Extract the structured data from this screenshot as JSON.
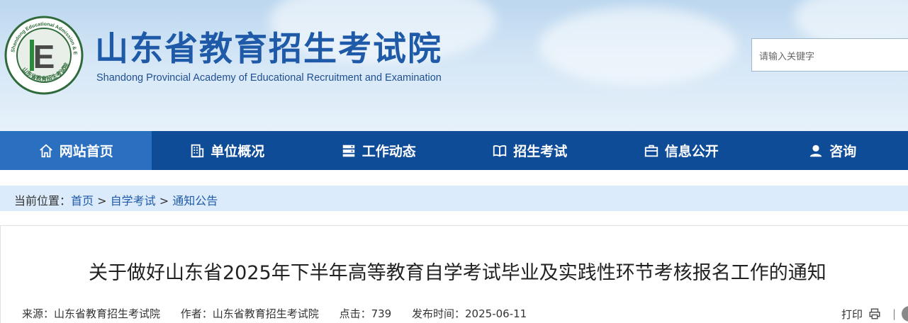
{
  "header": {
    "title": "山东省教育招生考试院",
    "subtitle": "Shandong Provincial Academy of Educational Recruitment and Examination",
    "seal_text_top": "Shandong Educational Admission & Examination",
    "seal_text_bottom": "山东省教育招生考试院",
    "seal_letter": "E",
    "search_placeholder": "请输入关键字"
  },
  "nav": {
    "items": [
      {
        "label": "网站首页",
        "icon": "home-icon"
      },
      {
        "label": "单位概况",
        "icon": "building-icon"
      },
      {
        "label": "工作动态",
        "icon": "server-icon"
      },
      {
        "label": "招生考试",
        "icon": "book-icon"
      },
      {
        "label": "信息公开",
        "icon": "briefcase-icon"
      },
      {
        "label": "咨询",
        "icon": "user-icon"
      }
    ]
  },
  "breadcrumb": {
    "prefix": "当前位置：",
    "items": [
      "首页",
      "自学考试",
      "通知公告"
    ],
    "separator": " > "
  },
  "article": {
    "title": "关于做好山东省2025年下半年高等教育自学考试毕业及实践性环节考核报名工作的通知",
    "source": "来源：山东省教育招生考试院",
    "author": "作者：山东省教育招生考试院",
    "clicks": "点击：739",
    "published": "发布时间：2025-06-11",
    "print_label": "打印",
    "divider": "|"
  },
  "colors": {
    "nav_bg": "#0f4c97",
    "nav_active": "#2b6fc1",
    "title_blue": "#1f5aa8",
    "breadcrumb_bg": "#dcebfb"
  }
}
